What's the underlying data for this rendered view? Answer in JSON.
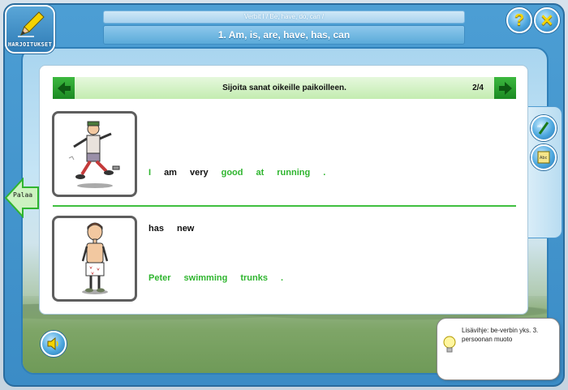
{
  "header": {
    "subtitle": "Verbit I / Be, have, do, can /",
    "title": "1. Am, is, are, have, has, can"
  },
  "badge": {
    "label": "HARJOITUKSET",
    "icon": "pencil-icon"
  },
  "top_buttons": {
    "help_glyph": "?",
    "close_glyph": "✕"
  },
  "exercise": {
    "instruction": "Sijoita sanat oikeille paikoilleen.",
    "page_counter": "2/4",
    "row1_words": [
      {
        "text": "I",
        "color": "green"
      },
      {
        "text": "am",
        "color": "black"
      },
      {
        "text": "very",
        "color": "black"
      },
      {
        "text": "good",
        "color": "green"
      },
      {
        "text": "at",
        "color": "green"
      },
      {
        "text": "running",
        "color": "green"
      },
      {
        "text": ".",
        "color": "green"
      }
    ],
    "row2_words": [
      {
        "text": "has",
        "color": "black"
      },
      {
        "text": "new",
        "color": "black"
      }
    ],
    "row3_words": [
      {
        "text": "Peter",
        "color": "green"
      },
      {
        "text": "swimming",
        "color": "green"
      },
      {
        "text": "trunks",
        "color": "green"
      },
      {
        "text": ".",
        "color": "green"
      }
    ]
  },
  "back_tab": {
    "label": "Palaa"
  },
  "hint": {
    "text": "Lisävihje: be-verbin yks. 3. persoonan muoto"
  },
  "colors": {
    "accent_green": "#2fb52f",
    "frame_blue": "#3b8cc6"
  }
}
